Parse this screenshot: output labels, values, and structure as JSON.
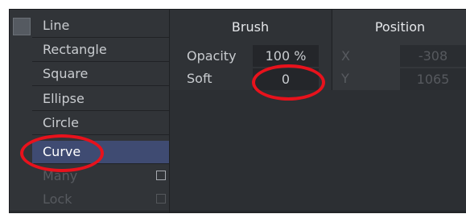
{
  "shape_list": {
    "items": [
      {
        "label": "Line"
      },
      {
        "label": "Rectangle"
      },
      {
        "label": "Square"
      },
      {
        "label": "Ellipse"
      },
      {
        "label": "Circle"
      },
      {
        "label": "Curve",
        "selected": true
      }
    ],
    "many_label": "Many",
    "lock_label": "Lock"
  },
  "brush": {
    "header": "Brush",
    "opacity_label": "Opacity",
    "opacity_value": "100 %",
    "soft_label": "Soft",
    "soft_value": "0"
  },
  "position": {
    "header": "Position",
    "x_label": "X",
    "x_value": "-308",
    "y_label": "Y",
    "y_value": "1065"
  },
  "colors": {
    "panel_bg": "#2c2f33",
    "selected_bg": "#3f4b72",
    "annotation": "#e8121c"
  }
}
